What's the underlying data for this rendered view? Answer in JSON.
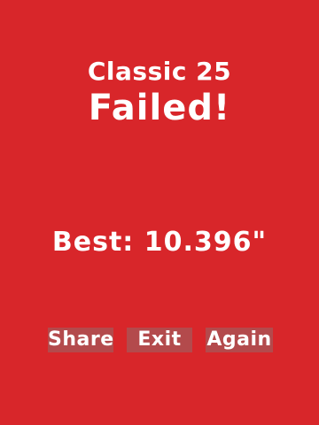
{
  "screen": {
    "background_color": "#D8262A",
    "button_color": "#B34A4C",
    "text_color": "#FFFFFF"
  },
  "header": {
    "mode_title": "Classic 25",
    "result": "Failed!"
  },
  "stats": {
    "best": "Best: 10.396\""
  },
  "buttons": {
    "share": "Share",
    "exit": "Exit",
    "again": "Again"
  }
}
